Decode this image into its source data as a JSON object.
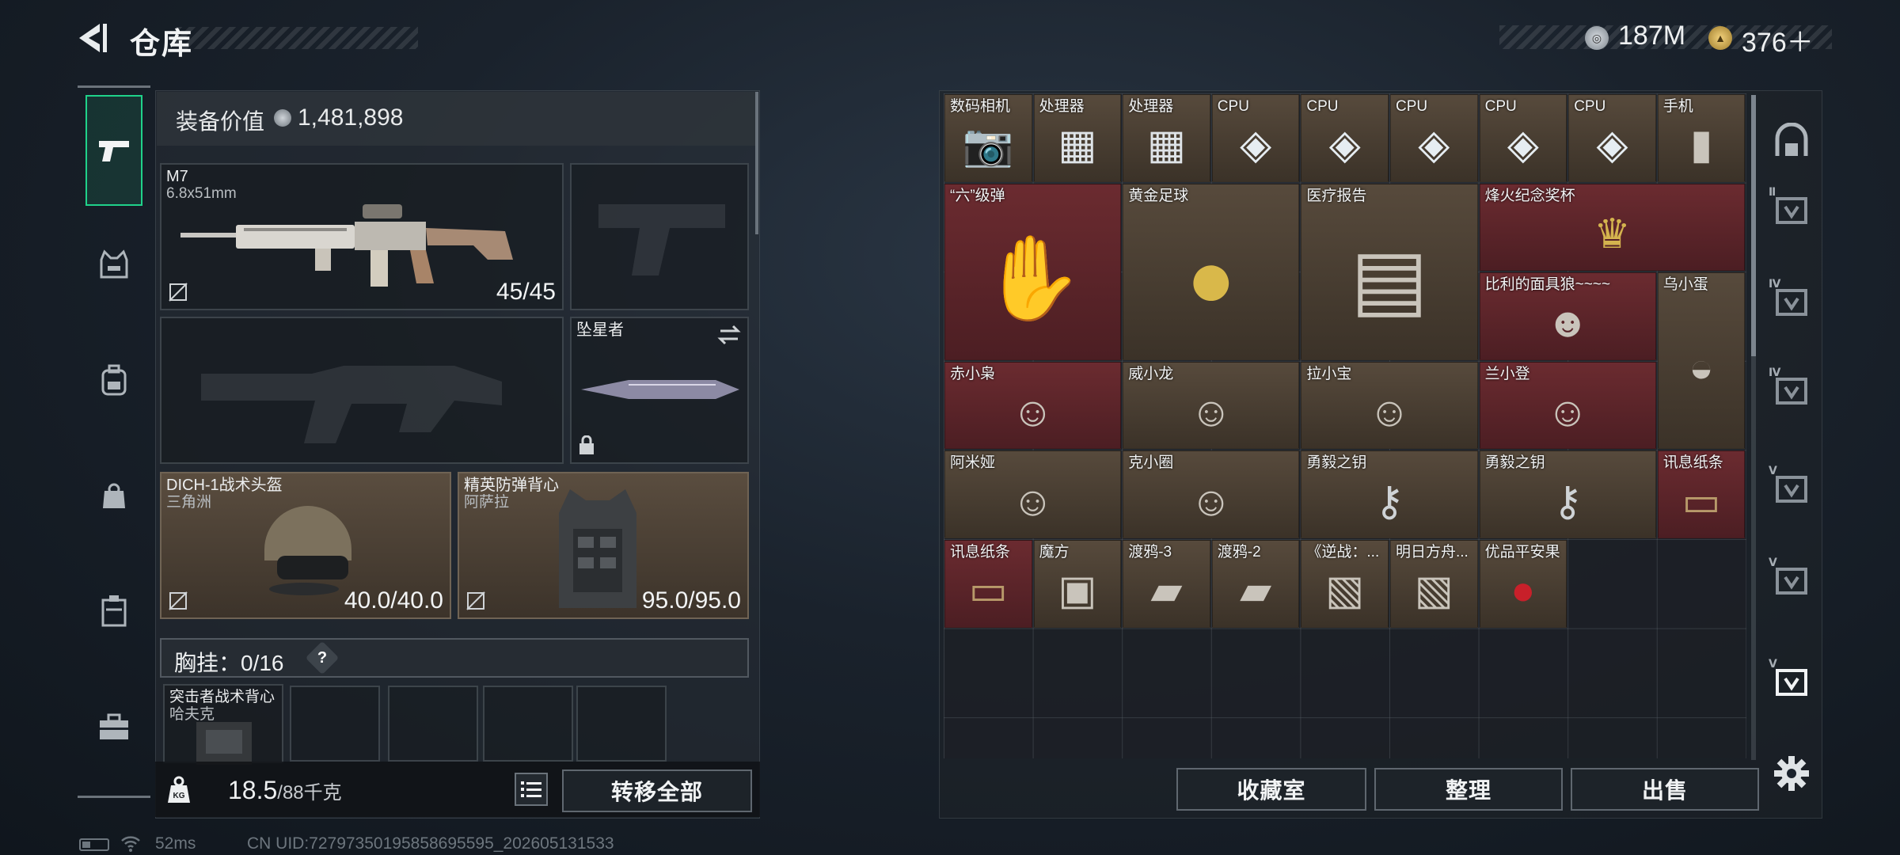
{
  "header": {
    "title": "仓库",
    "currency1_value": "187M",
    "currency2_value": "376＋"
  },
  "equipment": {
    "value_label": "装备价值",
    "value": "1,481,898",
    "primary_weapon": {
      "name": "M7",
      "caliber": "6.8x51mm",
      "ammo": "45/45"
    },
    "melee": {
      "name": "坠星者"
    },
    "helmet": {
      "name": "DICH-1战术头盔",
      "map": "三角洲",
      "durability": "40.0/40.0"
    },
    "armor": {
      "name": "精英防弹背心",
      "map": "阿萨拉",
      "durability": "95.0/95.0"
    },
    "chest_rig_label": "胸挂：0/16",
    "chest_rig_help": "?",
    "backpack": {
      "name": "突击者战术背心",
      "map": "哈夫克"
    },
    "weight_value": "18.5",
    "weight_max": "/88千克",
    "transfer_all": "转移全部"
  },
  "status": {
    "ping": "52ms",
    "uid": "CN UID:727973501958586955​95_202605131533"
  },
  "storage": {
    "items": [
      {
        "label": "数码相机",
        "color": "c-brown",
        "icon": "camera-icon"
      },
      {
        "label": "处理器",
        "color": "c-brown",
        "icon": "processor-icon"
      },
      {
        "label": "处理器",
        "color": "c-brown",
        "icon": "processor-icon"
      },
      {
        "label": "CPU",
        "color": "c-brown",
        "icon": "cpu-chip-icon"
      },
      {
        "label": "CPU",
        "color": "c-brown",
        "icon": "cpu-chip-icon"
      },
      {
        "label": "CPU",
        "color": "c-brown",
        "icon": "cpu-chip-icon"
      },
      {
        "label": "CPU",
        "color": "c-brown",
        "icon": "cpu-chip-icon"
      },
      {
        "label": "CPU",
        "color": "c-brown",
        "icon": "cpu-chip-icon"
      },
      {
        "label": "手机",
        "color": "c-brown",
        "icon": "phone-icon"
      },
      {
        "label": "“六”级弹",
        "color": "c-red",
        "icon": "bullet-hand-icon"
      },
      {
        "label": "黄金足球",
        "color": "c-brown",
        "icon": "golden-football-icon"
      },
      {
        "label": "医疗报告",
        "color": "c-brown",
        "icon": "medical-report-icon"
      },
      {
        "label": "烽火纪念奖杯",
        "color": "c-red",
        "icon": "trophy-icon"
      },
      {
        "label": "比利的面具狼~~~~",
        "color": "c-red",
        "icon": "doll-icon"
      },
      {
        "label": "乌小蛋",
        "color": "c-brown",
        "icon": "egg-figure-icon"
      },
      {
        "label": "赤小枭",
        "color": "c-red",
        "icon": "figure-icon"
      },
      {
        "label": "威小龙",
        "color": "c-brown",
        "icon": "figure-icon"
      },
      {
        "label": "拉小宝",
        "color": "c-brown",
        "icon": "figure-icon"
      },
      {
        "label": "兰小登",
        "color": "c-red",
        "icon": "figure-icon"
      },
      {
        "label": "阿米娅",
        "color": "c-brown",
        "icon": "figure-icon"
      },
      {
        "label": "克小圈",
        "color": "c-brown",
        "icon": "figure-icon"
      },
      {
        "label": "勇毅之钥",
        "color": "c-brown",
        "icon": "key-icon"
      },
      {
        "label": "勇毅之钥",
        "color": "c-brown",
        "icon": "key-icon"
      },
      {
        "label": "讯息纸条",
        "color": "c-red",
        "icon": "note-icon"
      },
      {
        "label": "讯息纸条",
        "color": "c-red",
        "icon": "note-icon"
      },
      {
        "label": "魔方",
        "color": "c-brown",
        "icon": "cube-icon"
      },
      {
        "label": "渡鸦-3",
        "color": "c-brown",
        "icon": "tape-icon"
      },
      {
        "label": "渡鸦-2",
        "color": "c-brown",
        "icon": "tape-icon"
      },
      {
        "label": "《逆战：...",
        "color": "c-brown",
        "icon": "album-icon"
      },
      {
        "label": "明日方舟...",
        "color": "c-brown",
        "icon": "album-icon"
      },
      {
        "label": "优品平安果",
        "color": "c-brown",
        "icon": "apple-icon"
      }
    ],
    "collection_room": "收藏室",
    "organize": "整理",
    "sell": "出售"
  },
  "right_nav_tags": [
    "",
    "Ⅱ",
    "Ⅳ",
    "Ⅳ",
    "Ⅴ",
    "Ⅴ",
    "Ⅴ"
  ]
}
